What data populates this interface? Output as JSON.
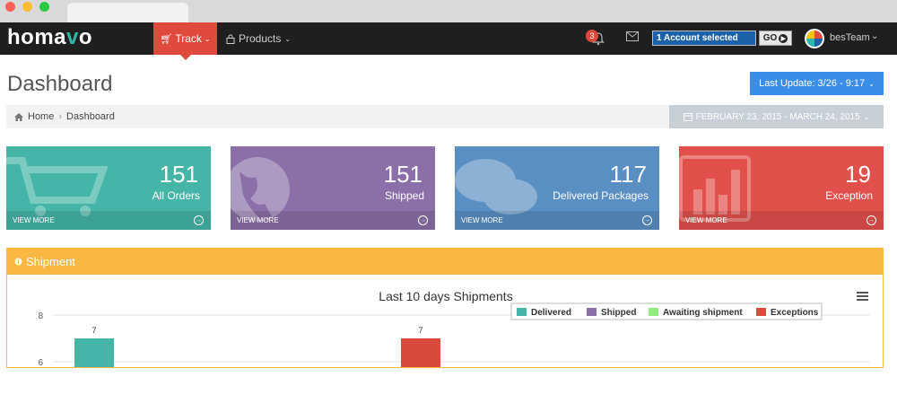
{
  "app": {
    "logo_left": "homa",
    "logo_accent": "v",
    "logo_right": "o"
  },
  "nav": {
    "track_label": "Track",
    "products_label": "Products",
    "notification_count": "3",
    "account_selected": "1 Account selected",
    "go_label": "GO",
    "user_name": "besTeam"
  },
  "header": {
    "title": "Dashboard",
    "last_update": "Last Update: 3/26 - 9:17"
  },
  "breadcrumb": {
    "home": "Home",
    "current": "Dashboard"
  },
  "date_range": "FEBRUARY 23, 2015 - MARCH 24, 2015",
  "cards": [
    {
      "value": "151",
      "label": "All Orders",
      "more": "VIEW MORE",
      "icon": "cart-icon"
    },
    {
      "value": "151",
      "label": "Shipped",
      "more": "VIEW MORE",
      "icon": "globe-icon"
    },
    {
      "value": "117",
      "label": "Delivered Packages",
      "more": "VIEW MORE",
      "icon": "chat-bubbles-icon"
    },
    {
      "value": "19",
      "label": "Exception",
      "more": "VIEW MORE",
      "icon": "bar-chart-icon"
    }
  ],
  "colors": {
    "teal": "#44b5a7",
    "purple": "#8a6fa8",
    "blue": "#5a8fc3",
    "red": "#e2504c",
    "orange": "#fab843",
    "nav_red": "#e04a3c"
  },
  "panel": {
    "title": "Shipment"
  },
  "chart_data": {
    "type": "bar",
    "title": "Last 10 days Shipments",
    "ylim_visible": [
      6,
      8
    ],
    "yticks": [
      "8",
      "6"
    ],
    "legend_position": "top-right",
    "series": [
      {
        "name": "Delivered",
        "color": "#44b5a7"
      },
      {
        "name": "Shipped",
        "color": "#8a6fa8"
      },
      {
        "name": "Awaiting shipment",
        "color": "#90ed7d"
      },
      {
        "name": "Exceptions",
        "color": "#d94a3c"
      }
    ],
    "visible_bars": [
      {
        "series": "Delivered",
        "value": 7,
        "label": "7"
      },
      {
        "series": "Exceptions",
        "value": 7,
        "label": "7"
      }
    ]
  }
}
